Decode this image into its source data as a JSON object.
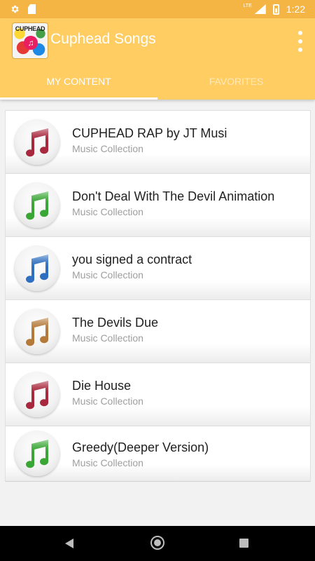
{
  "status_bar": {
    "time": "1:22",
    "network_label": "LTE",
    "icons": [
      "gear-icon",
      "sd-card-icon",
      "signal-icon",
      "battery-charging-icon"
    ],
    "color": "#f5b544"
  },
  "app_bar": {
    "title": "Cuphead Songs",
    "logo_text": "CUPHEAD",
    "logo_glyph": "♫",
    "color": "#ffcd62",
    "menu_icon": "overflow-menu-icon"
  },
  "tabs": [
    {
      "label": "MY CONTENT",
      "active": true
    },
    {
      "label": "FAVORITES",
      "active": false
    }
  ],
  "songs": [
    {
      "title": "CUPHEAD RAP by JT Musi",
      "subtitle": "Music Collection",
      "icon_color": "#a8283d"
    },
    {
      "title": "Don't Deal With The Devil Animation",
      "subtitle": "Music Collection",
      "icon_color": "#3aa636"
    },
    {
      "title": "you signed a contract",
      "subtitle": "Music Collection",
      "icon_color": "#2f6fbf"
    },
    {
      "title": "The Devils Due",
      "subtitle": "Music Collection",
      "icon_color": "#b57a3a"
    },
    {
      "title": "Die House",
      "subtitle": "Music Collection",
      "icon_color": "#a8283d"
    },
    {
      "title": "Greedy(Deeper Version)",
      "subtitle": "Music Collection",
      "icon_color": "#3aa636"
    }
  ],
  "nav_bar": {
    "icons": [
      "back-icon",
      "home-icon",
      "recents-icon"
    ]
  }
}
